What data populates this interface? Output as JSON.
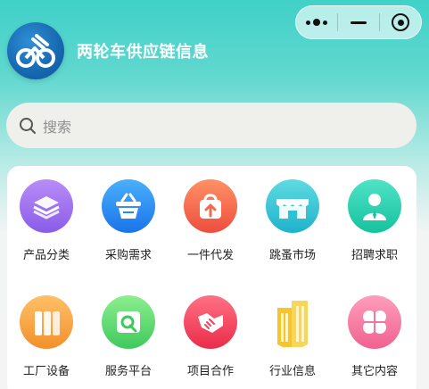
{
  "header": {
    "app_title": "两轮车供应链信息"
  },
  "search": {
    "placeholder": "搜索",
    "icon": "search-icon"
  },
  "capsule": {
    "more_icon": "more-dots-icon",
    "minimize_icon": "minimize-icon",
    "close_icon": "target-icon"
  },
  "grid": {
    "items": [
      {
        "label": "产品分类",
        "icon": "layers-icon",
        "color": "#9a6cf0"
      },
      {
        "label": "采购需求",
        "icon": "basket-icon",
        "color": "#2a86f3"
      },
      {
        "label": "一件代发",
        "icon": "bag-upload-icon",
        "color": "#f26a4c"
      },
      {
        "label": "跳蚤市场",
        "icon": "market-stall-icon",
        "color": "#2cc3d4"
      },
      {
        "label": "招聘求职",
        "icon": "person-tie-icon",
        "color": "#27d3b1"
      },
      {
        "label": "工厂设备",
        "icon": "factory-columns-icon",
        "color": "#f6a23a"
      },
      {
        "label": "服务平台",
        "icon": "service-platform-icon",
        "color": "#53d56d"
      },
      {
        "label": "项目合作",
        "icon": "handshake-icon",
        "color": "#f2445b"
      },
      {
        "label": "行业信息",
        "icon": "buildings-icon",
        "color": "#f3c22a"
      },
      {
        "label": "其它内容",
        "icon": "clover-icon",
        "color": "#f278a3"
      }
    ]
  }
}
